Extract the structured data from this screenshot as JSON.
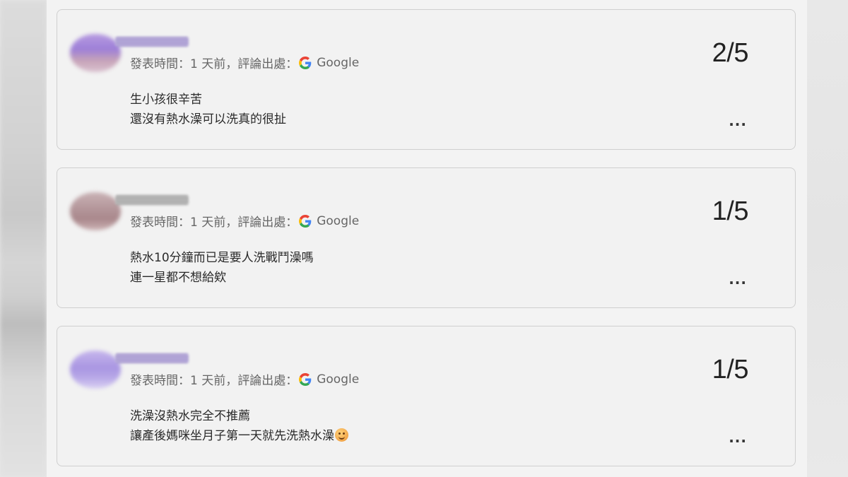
{
  "reviews": [
    {
      "meta_prefix": "發表時間：1 天前，評論出處：",
      "source_label": "Google",
      "rating": "2/5",
      "lines": [
        "生小孩很辛苦",
        "還沒有熱水澡可以洗真的很扯"
      ],
      "more_label": "..."
    },
    {
      "meta_prefix": "發表時間：1 天前，評論出處：",
      "source_label": "Google",
      "rating": "1/5",
      "lines": [
        "熱水10分鐘而已是要人洗戰鬥澡嗎",
        "連一星都不想給欸"
      ],
      "more_label": "..."
    },
    {
      "meta_prefix": "發表時間：1 天前，評論出處：",
      "source_label": "Google",
      "rating": "1/5",
      "lines": [
        "洗澡沒熱水完全不推薦",
        "讓產後媽咪坐月子第一天就先洗熱水澡"
      ],
      "more_label": "..."
    }
  ],
  "icons": {
    "source_icon": "google-g-icon",
    "emoji_icon": "smiling-face-emoji-icon",
    "more_icon": "more-options-icon"
  }
}
